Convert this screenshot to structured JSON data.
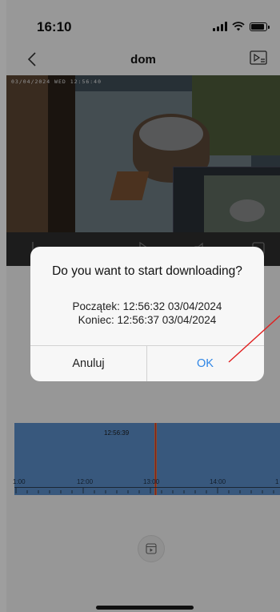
{
  "status_bar": {
    "time": "16:10"
  },
  "nav": {
    "title": "dom",
    "back_icon": "chevron-left-icon",
    "playlist_icon": "playlist-icon"
  },
  "video": {
    "timestamp": "03/04/2024 WED 12:56:40"
  },
  "dialog": {
    "title": "Do you want to start downloading?",
    "start_line": "Początek:  12:56:32 03/04/2024",
    "end_line": "Koniec:  12:56:37 03/04/2024",
    "cancel_label": "Anuluj",
    "ok_label": "OK"
  },
  "timeline": {
    "cursor_time": "12:56:39",
    "tick_labels": [
      "1:00",
      "12:00",
      "13:00",
      "14:00",
      "1"
    ]
  },
  "colors": {
    "accent": "#2f86e6",
    "timeline_bg": "#5b8fca",
    "marker": "#e9783a"
  }
}
